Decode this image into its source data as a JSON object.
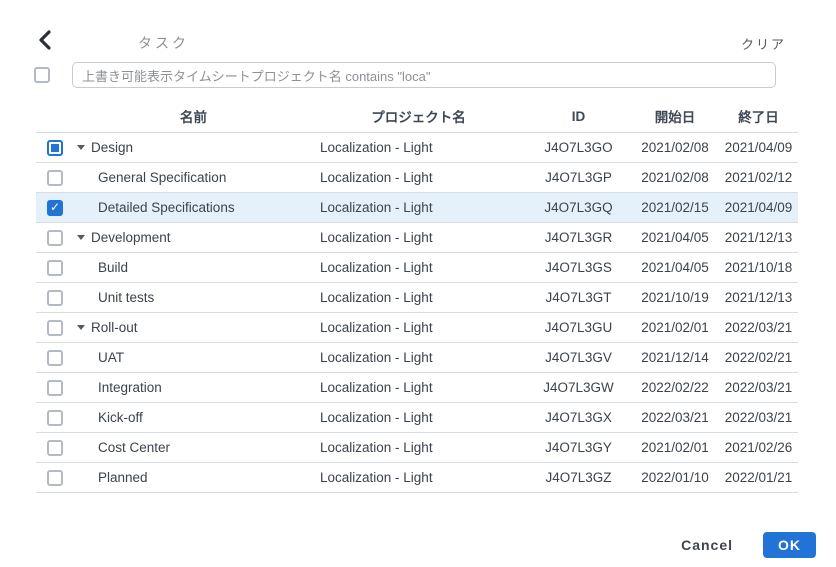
{
  "header": {
    "title": "タスク",
    "clear_label": "クリア"
  },
  "filter": {
    "select_all_checked": false,
    "query": "上書き可能表示タイムシートプロジェクト名 contains \"loca\""
  },
  "table": {
    "columns": {
      "name": "名前",
      "project": "プロジェクト名",
      "id": "ID",
      "start_date": "開始日",
      "end_date": "終了日"
    },
    "rows": [
      {
        "name": "Design",
        "parent": true,
        "checkbox": "indeterminate",
        "selected": false,
        "project": "Localization - Light",
        "id": "J4O7L3GO",
        "start": "2021/02/08",
        "end": "2021/04/09"
      },
      {
        "name": "General Specification",
        "parent": false,
        "checkbox": "unchecked",
        "selected": false,
        "project": "Localization - Light",
        "id": "J4O7L3GP",
        "start": "2021/02/08",
        "end": "2021/02/12"
      },
      {
        "name": "Detailed Specifications",
        "parent": false,
        "checkbox": "checked",
        "selected": true,
        "project": "Localization - Light",
        "id": "J4O7L3GQ",
        "start": "2021/02/15",
        "end": "2021/04/09"
      },
      {
        "name": "Development",
        "parent": true,
        "checkbox": "unchecked",
        "selected": false,
        "project": "Localization - Light",
        "id": "J4O7L3GR",
        "start": "2021/04/05",
        "end": "2021/12/13"
      },
      {
        "name": "Build",
        "parent": false,
        "checkbox": "unchecked",
        "selected": false,
        "project": "Localization - Light",
        "id": "J4O7L3GS",
        "start": "2021/04/05",
        "end": "2021/10/18"
      },
      {
        "name": "Unit tests",
        "parent": false,
        "checkbox": "unchecked",
        "selected": false,
        "project": "Localization - Light",
        "id": "J4O7L3GT",
        "start": "2021/10/19",
        "end": "2021/12/13"
      },
      {
        "name": "Roll-out",
        "parent": true,
        "checkbox": "unchecked",
        "selected": false,
        "project": "Localization - Light",
        "id": "J4O7L3GU",
        "start": "2021/02/01",
        "end": "2022/03/21"
      },
      {
        "name": "UAT",
        "parent": false,
        "checkbox": "unchecked",
        "selected": false,
        "project": "Localization - Light",
        "id": "J4O7L3GV",
        "start": "2021/12/14",
        "end": "2022/02/21"
      },
      {
        "name": "Integration",
        "parent": false,
        "checkbox": "unchecked",
        "selected": false,
        "project": "Localization - Light",
        "id": "J4O7L3GW",
        "start": "2022/02/22",
        "end": "2022/03/21"
      },
      {
        "name": "Kick-off",
        "parent": false,
        "checkbox": "unchecked",
        "selected": false,
        "project": "Localization - Light",
        "id": "J4O7L3GX",
        "start": "2022/03/21",
        "end": "2022/03/21"
      },
      {
        "name": "Cost Center",
        "parent": false,
        "checkbox": "unchecked",
        "selected": false,
        "project": "Localization - Light",
        "id": "J4O7L3GY",
        "start": "2021/02/01",
        "end": "2021/02/26"
      },
      {
        "name": "Planned",
        "parent": false,
        "checkbox": "unchecked",
        "selected": false,
        "project": "Localization - Light",
        "id": "J4O7L3GZ",
        "start": "2022/01/10",
        "end": "2022/01/21"
      }
    ]
  },
  "footer": {
    "cancel_label": "Cancel",
    "ok_label": "OK"
  },
  "colors": {
    "accent_blue": "#2173d6",
    "selected_row": "#e5f1fa"
  },
  "icons": {
    "back": "chevron-left-icon",
    "expand": "triangle-down-icon"
  }
}
